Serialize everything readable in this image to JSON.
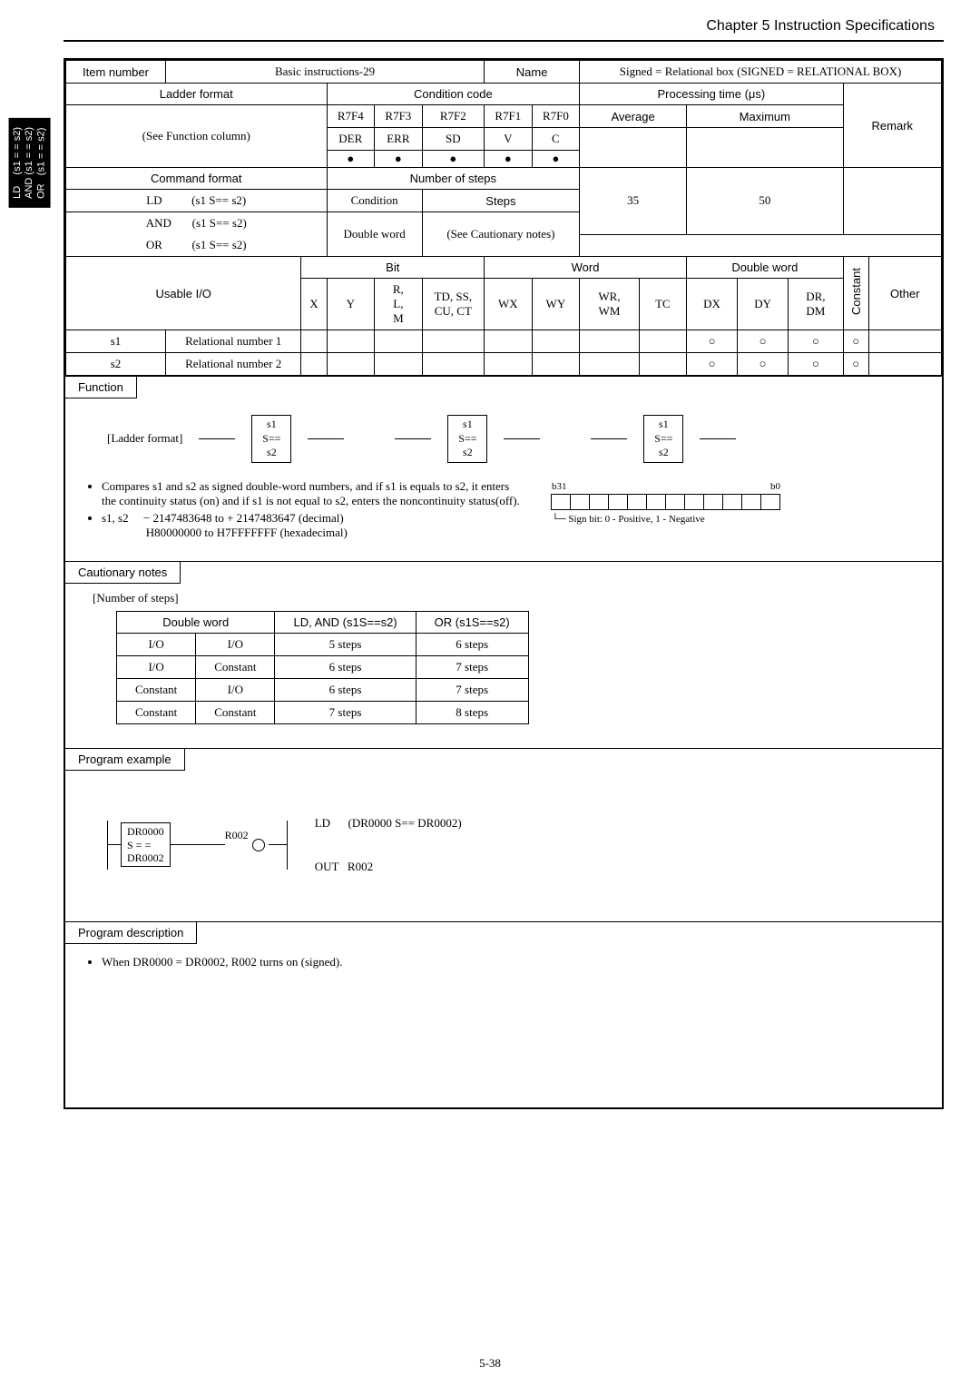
{
  "chapter": "Chapter 5  Instruction Specifications",
  "side_tab": "LD    (s1 = = s2)\nAND (s1 = = s2)\nOR   (s1 = = s2)",
  "row1": {
    "item_number": "Item number",
    "basic": "Basic instructions-29",
    "name_label": "Name",
    "name_text": "Signed = Relational box (SIGNED = RELATIONAL BOX)"
  },
  "row2": {
    "ladder_format": "Ladder format",
    "cond_code": "Condition code",
    "proc_time": "Processing time (μs)",
    "remark": "Remark"
  },
  "cond_headers": [
    "R7F4",
    "R7F3",
    "R7F2",
    "R7F1",
    "R7F0"
  ],
  "cond_row2": [
    "DER",
    "ERR",
    "SD",
    "V",
    "C"
  ],
  "avg": "Average",
  "max": "Maximum",
  "see_func": "(See Function column)",
  "cmd_format": "Command format",
  "num_steps": "Number of steps",
  "steps_35": "35",
  "steps_50": "50",
  "cmd_lines": {
    "ld": "LD          (s1 S== s2)",
    "and": "AND       (s1 S== s2)",
    "or": "OR          (s1 S== s2)",
    "cond": "Condition",
    "dblword": "Double word",
    "stepslbl": "Steps",
    "see_caut": "(See Cautionary notes)"
  },
  "usable": {
    "label": "Usable I/O",
    "bit": "Bit",
    "word": "Word",
    "dbl": "Double word",
    "x": "X",
    "y": "Y",
    "rlm": "R,\nL,\nM",
    "tdss": "TD, SS,\nCU, CT",
    "wx": "WX",
    "wy": "WY",
    "wrwm": "WR,\nWM",
    "tc": "TC",
    "dx": "DX",
    "dy": "DY",
    "drdm": "DR,\nDM",
    "const": "Constant",
    "other": "Other"
  },
  "s1": "s1",
  "s2": "s2",
  "rel1": "Relational number 1",
  "rel2": "Relational number 2",
  "function_label": "Function",
  "ladder_label": "[Ladder format]",
  "box_s": "s1\nS==\ns2",
  "bullet1": "Compares s1 and s2 as signed double-word numbers, and if s1 is equals to s2, it enters the continuity status (on) and if s1 is not equal to s2, enters the noncontinuity status(off).",
  "bullet2_label": "s1, s2",
  "bullet2_a": "− 2147483648 to + 2147483647 (decimal)",
  "bullet2_b": "H80000000 to H7FFFFFFF (hexadecimal)",
  "b31": "b31",
  "b0": "b0",
  "signbit": "Sign bit: 0 - Positive, 1 - Negative",
  "caut_label": "Cautionary notes",
  "num_steps_label": "[Number of steps]",
  "steps_hdr": {
    "dbl": "Double word",
    "ld": "LD, AND (s1S==s2)",
    "or": "OR (s1S==s2)"
  },
  "steps_rows": [
    [
      "I/O",
      "I/O",
      "5 steps",
      "6 steps"
    ],
    [
      "I/O",
      "Constant",
      "6 steps",
      "7 steps"
    ],
    [
      "Constant",
      "I/O",
      "6 steps",
      "7 steps"
    ],
    [
      "Constant",
      "Constant",
      "7 steps",
      "8 steps"
    ]
  ],
  "progex_label": "Program example",
  "progex": {
    "dr0000": "DR0000",
    "s": "S = =",
    "dr0002": "DR0002",
    "r002": "R002",
    "ld": "LD      (DR0000 S== DR0002)",
    "out": "OUT   R002"
  },
  "progdesc_label": "Program description",
  "progdesc_text": "When DR0000 = DR0002, R002 turns on (signed).",
  "footer": "5-38"
}
